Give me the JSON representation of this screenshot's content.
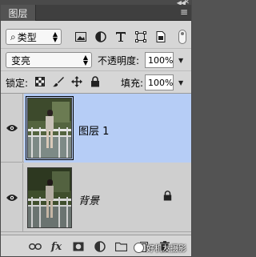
{
  "panel": {
    "tab_label": "图层",
    "menu_glyph": "≡"
  },
  "filter": {
    "kind_label": "类型",
    "search_glyph": "⌕"
  },
  "blend": {
    "mode_value": "变亮",
    "opacity_label": "不透明度:",
    "opacity_value": "100%"
  },
  "lock": {
    "label": "锁定:",
    "fill_label": "填充:",
    "fill_value": "100%"
  },
  "layers": [
    {
      "name": "图层 1",
      "selected": true,
      "visible": true,
      "locked": false
    },
    {
      "name": "背景",
      "selected": false,
      "visible": true,
      "locked": true
    }
  ],
  "bottom_bar": {
    "fx_label": "fx"
  },
  "watermark": {
    "text": "好机友摄影"
  }
}
